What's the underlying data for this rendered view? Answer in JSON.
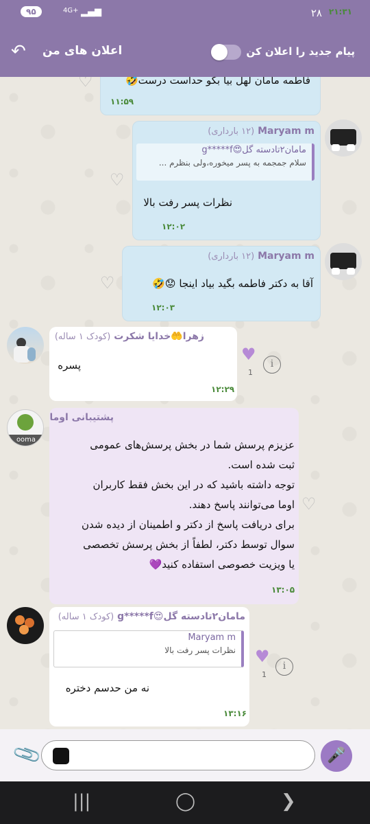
{
  "status": {
    "time": "۲۱:۳۱",
    "date": "۲۸",
    "battery": "۹۵",
    "network": "4G+"
  },
  "header": {
    "title": "اعلان های من",
    "notify_label": "پیام جدید را اعلان کن",
    "back_icon": "back-arrow-icon"
  },
  "messages": [
    {
      "partial_text": "فاطمه  مامان لهل بیا بگو حداست درست🤣",
      "time": "۱۱:۵۹"
    },
    {
      "sender": "Maryam m",
      "sender_sub": "(۱۲ بارداری)",
      "quote_name": "مامان۲تادسته گل😍g*****f",
      "quote_text": "سلام جمجمه به  پسر میخوره،ولی بنظرم ...",
      "text": "نظرات پسر رفت بالا",
      "time": "۱۲:۰۲"
    },
    {
      "sender": "Maryam m",
      "sender_sub": "(۱۲ بارداری)",
      "text": "آقا به دکتر  فاطمه بگید بیاد اینجا 😟🤣",
      "time": "۱۲:۰۳"
    },
    {
      "sender": "زهرا🤲خدایا شکرت",
      "sender_sub": "(کودک ۱ ساله)",
      "text": "پسره",
      "time": "۱۲:۲۹",
      "likes": "1"
    },
    {
      "sender": "پشتیبانی اوما",
      "text_lines": [
        "عزیزم پرسش شما در بخش پرسش‌های عمومی",
        "ثبت شده است.",
        "توجه داشته باشید که در این بخش فقط کاربران",
        "اوما می‌توانند پاسخ دهند.",
        "برای دریافت پاسخ از دکتر و اطمینان از دیده شدن",
        "سوال توسط دکتر، لطفاً از بخش پرسش تخصصی",
        "یا ویزیت خصوصی استفاده کنید💜"
      ],
      "time": "۱۳:۰۵",
      "avatar_label": "ooma"
    },
    {
      "sender": "مامان۲تادسته گل😍g*****f",
      "sender_sub": "(کودک ۱ ساله)",
      "quote_name": "Maryam m",
      "quote_text": "نظرات پسر رفت بالا",
      "text": "نه من حدسم دختره",
      "time": "۱۳:۱۶",
      "likes": "1"
    }
  ],
  "composer": {
    "placeholder": ""
  },
  "colors": {
    "header": "#8c78a9",
    "outgoing": "#d3e9f4",
    "incoming": "#ffffff",
    "support": "#efe5f5",
    "time": "#4a8a3a",
    "accent": "#9c7ac4"
  }
}
